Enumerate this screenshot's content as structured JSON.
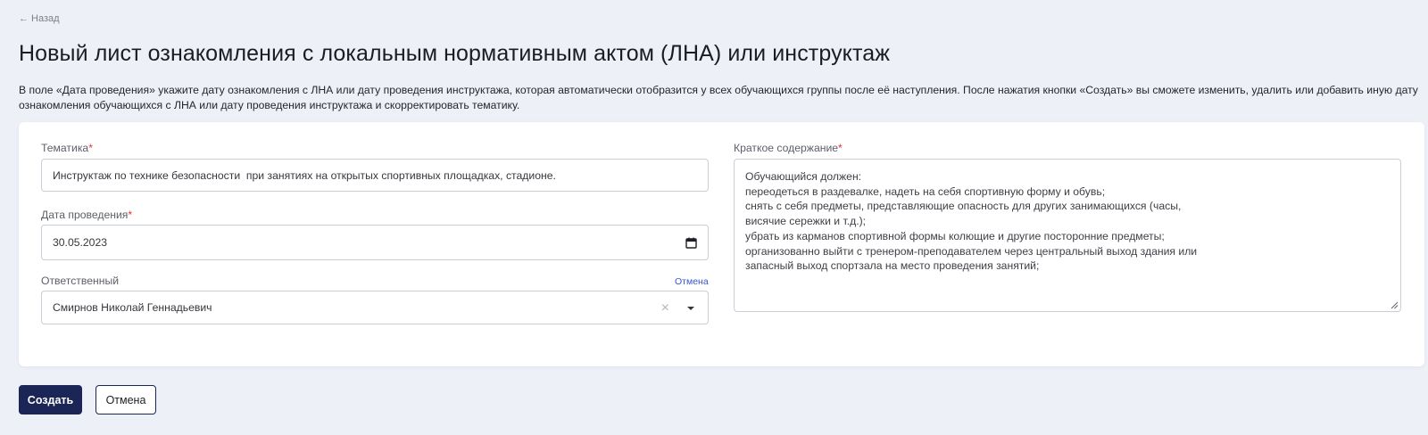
{
  "nav": {
    "back_label": "Назад"
  },
  "page": {
    "title": "Новый лист ознакомления с локальным нормативным актом (ЛНА) или инструктаж",
    "intro": "В поле «Дата проведения» укажите дату ознакомления с ЛНА или дату проведения инструктажа, которая автоматически отобразится у всех обучающихся группы после её наступления. После нажатия кнопки «Создать» вы сможете изменить, удалить или добавить иную дату ознакомления обучающихся с ЛНА или дату проведения инструктажа и скорректировать тематику."
  },
  "form": {
    "topic": {
      "label": "Тематика",
      "required_mark": "*",
      "value": "Инструктаж по технике безопасности  при занятиях на открытых спортивных площадках, стадионе."
    },
    "date": {
      "label": "Дата проведения",
      "required_mark": "*",
      "value": "30.05.2023"
    },
    "responsible": {
      "label": "Ответственный",
      "cancel_link": "Отмена",
      "value": "Смирнов Николай Геннадьевич",
      "clear_glyph": "×"
    },
    "summary": {
      "label": "Краткое содержание",
      "required_mark": "*",
      "lines": [
        "Обучающийся должен:",
        "переодеться в раздевалке, надеть на себя спортивную форму и обувь;",
        "снять с себя предметы, представляющие опасность для других занимающихся (часы,",
        "висячие сережки и т.д.);",
        "убрать из карманов спортивной формы колющие и другие посторонние предметы;",
        "организованно выйти с тренером-преподавателем через центральный выход здания или",
        "запасный выход спортзала на место проведения занятий;"
      ]
    }
  },
  "actions": {
    "create_label": "Создать",
    "cancel_label": "Отмена"
  },
  "colors": {
    "background": "#eef0f8",
    "primary_button": "#1b2656",
    "required": "#e0343a",
    "link": "#3a55c7"
  },
  "icons": [
    "arrow-left-icon",
    "calendar-icon",
    "clear-icon",
    "chevron-down-icon",
    "resize-grip-icon"
  ]
}
